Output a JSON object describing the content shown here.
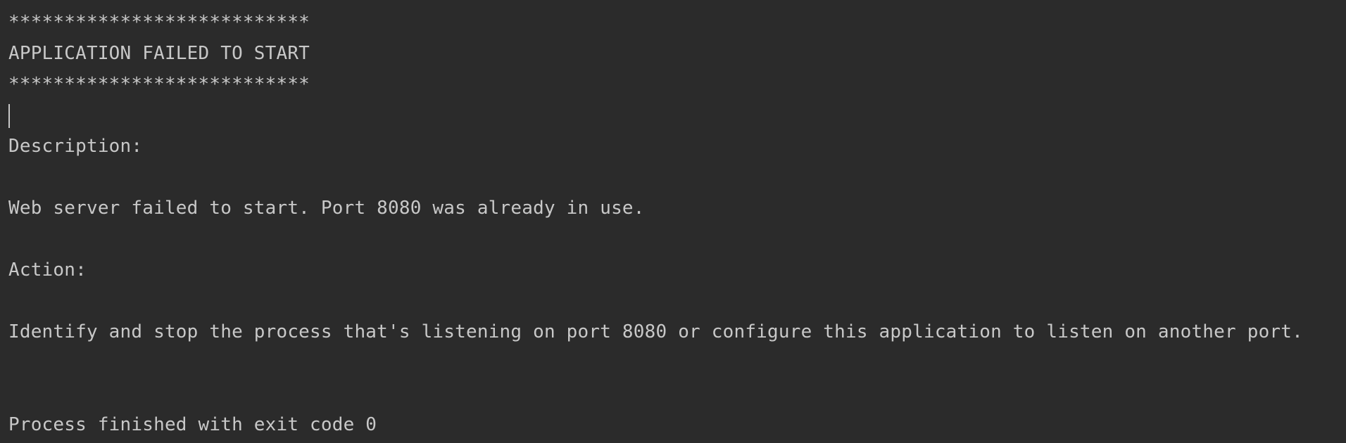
{
  "console": {
    "lines": {
      "stars_top": "***************************",
      "header": "APPLICATION FAILED TO START",
      "stars_bottom": "***************************",
      "description_label": "Description:",
      "description_text": "Web server failed to start. Port 8080 was already in use.",
      "action_label": "Action:",
      "action_text": "Identify and stop the process that's listening on port 8080 or configure this application to listen on another port.",
      "process_status": "Process finished with exit code 0"
    }
  },
  "colors": {
    "background": "#2b2b2b",
    "text": "#c8c8c8"
  }
}
